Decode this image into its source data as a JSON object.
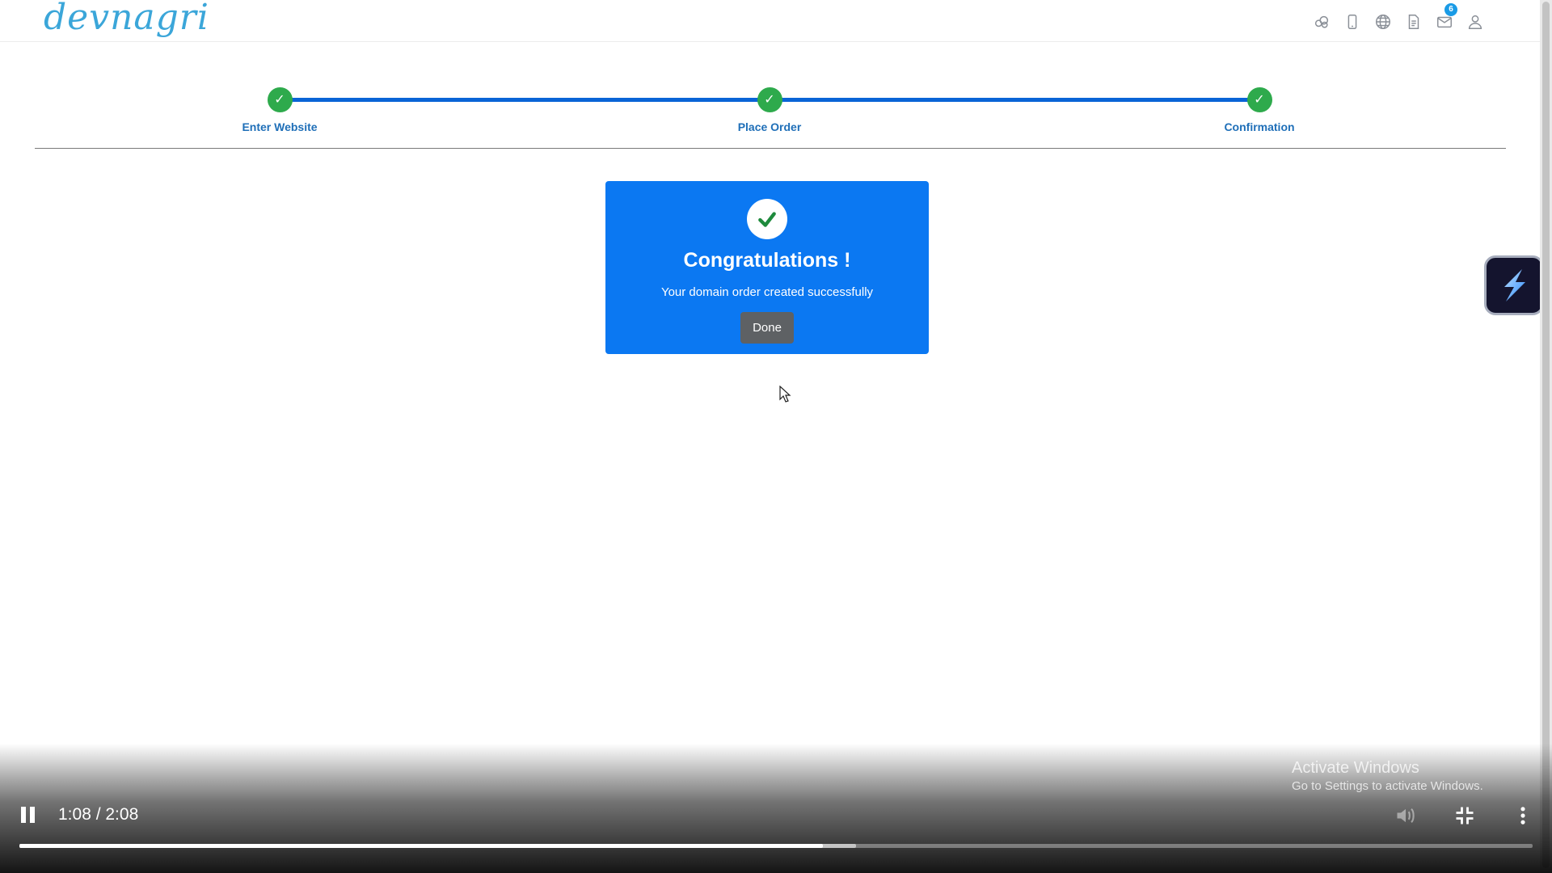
{
  "header": {
    "logo_text": "devnagri",
    "icons": [
      "cloud-icon",
      "mobile-icon",
      "globe-icon",
      "document-icon",
      "mail-icon",
      "user-icon"
    ],
    "mail_badge": "6"
  },
  "stepper": {
    "steps": [
      {
        "label": "Enter Website",
        "status": "done"
      },
      {
        "label": "Place Order",
        "status": "done"
      },
      {
        "label": "Confirmation",
        "status": "done"
      }
    ],
    "check_glyph": "✓"
  },
  "success_card": {
    "title": "Congratulations !",
    "message": "Your domain order created successfully",
    "button_label": "Done"
  },
  "colors": {
    "accent_blue": "#0b78f2",
    "step_green": "#2eaa4c",
    "step_line": "#0a64d6",
    "button_gray": "#5e6164"
  },
  "watermark": {
    "title": "Activate Windows",
    "subtitle": "Go to Settings to activate Windows."
  },
  "video_player": {
    "time": "1:08 / 2:08",
    "played_fraction": 0.531,
    "buffered_fraction": 0.553
  }
}
